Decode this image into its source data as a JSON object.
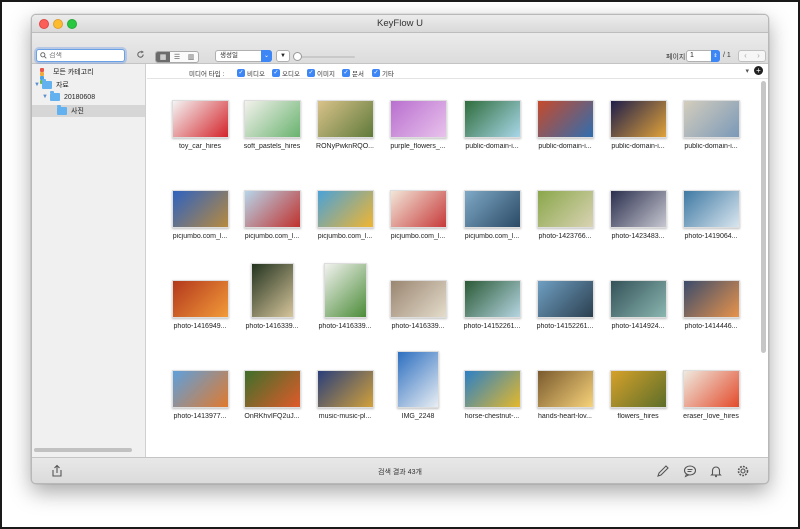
{
  "window": {
    "title": "KeyFlow U"
  },
  "toolbar": {
    "search_placeholder": "검색",
    "sort_value": "생성일",
    "page_label": "페이지",
    "page_value": "1",
    "page_total": "/ 1"
  },
  "sidebar": {
    "all_categories": "모든 카테고리",
    "library": "자료",
    "folder_date": "20180608",
    "folder_photos": "사진"
  },
  "filter": {
    "label": "미디어 타입 :",
    "types": [
      "비디오",
      "오디오",
      "이미지",
      "문서",
      "기타"
    ]
  },
  "items": [
    {
      "name": "toy_car_hires",
      "c1": "#f4f4f4",
      "c2": "#d3242a"
    },
    {
      "name": "soft_pastels_hires",
      "c1": "#f3f1ec",
      "c2": "#69b36f"
    },
    {
      "name": "RONyPwknRQO...",
      "c1": "#d9c28a",
      "c2": "#5f7a3a"
    },
    {
      "name": "purple_flowers_...",
      "c1": "#b96fcf",
      "c2": "#e8c2ec"
    },
    {
      "name": "public-domain-i...",
      "c1": "#2f6d3c",
      "c2": "#a8d7e9"
    },
    {
      "name": "public-domain-i...",
      "c1": "#c64a2b",
      "c2": "#2f6eb0"
    },
    {
      "name": "public-domain-i...",
      "c1": "#1f1f4a",
      "c2": "#e0a23a"
    },
    {
      "name": "public-domain-i...",
      "c1": "#d4cdbd",
      "c2": "#7a99b8"
    },
    {
      "name": "picjumbo.com_l...",
      "c1": "#2e62c0",
      "c2": "#b78a3e"
    },
    {
      "name": "picjumbo.com_l...",
      "c1": "#b7d5ea",
      "c2": "#c0312d"
    },
    {
      "name": "picjumbo.com_l...",
      "c1": "#4aa2d8",
      "c2": "#f0b531"
    },
    {
      "name": "picjumbo.com_l...",
      "c1": "#f2e6d8",
      "c2": "#c73a3a"
    },
    {
      "name": "picjumbo.com_l...",
      "c1": "#7ea9c6",
      "c2": "#2b4a66"
    },
    {
      "name": "photo-1423766...",
      "c1": "#8aa74a",
      "c2": "#d9d3b4"
    },
    {
      "name": "photo-1423483...",
      "c1": "#2a2f4d",
      "c2": "#c7c7d1"
    },
    {
      "name": "photo-1419064...",
      "c1": "#3f79a3",
      "c2": "#d9e6ef"
    },
    {
      "name": "photo-1416949...",
      "c1": "#b3381d",
      "c2": "#f29b39"
    },
    {
      "name": "photo-1416339...",
      "c1": "#23331f",
      "c2": "#d6c59b"
    },
    {
      "name": "photo-1416339...",
      "c1": "#f2f2ef",
      "c2": "#4b8c38"
    },
    {
      "name": "photo-1416339...",
      "c1": "#9a8671",
      "c2": "#e4dccb"
    },
    {
      "name": "photo-14152261...",
      "c1": "#2b5a36",
      "c2": "#b5d5e2"
    },
    {
      "name": "photo-14152261...",
      "c1": "#6f9fc2",
      "c2": "#2b3f4f"
    },
    {
      "name": "photo-1414924...",
      "c1": "#345259",
      "c2": "#8ab6b0"
    },
    {
      "name": "photo-1414446...",
      "c1": "#3b4c6c",
      "c2": "#e8934a"
    },
    {
      "name": "photo-1413977...",
      "c1": "#5ea0dc",
      "c2": "#e07a2d"
    },
    {
      "name": "OnRKhvIFQ2uJ...",
      "c1": "#3f6f2a",
      "c2": "#e05a2a"
    },
    {
      "name": "music-music-pl...",
      "c1": "#2a3f7a",
      "c2": "#d2a13a"
    },
    {
      "name": "IMG_2248",
      "c1": "#2c6fc0",
      "c2": "#e9eef3"
    },
    {
      "name": "horse-chestnut-...",
      "c1": "#2c80c6",
      "c2": "#e3b82c"
    },
    {
      "name": "hands-heart-lov...",
      "c1": "#7a5a2e",
      "c2": "#f7d37a"
    },
    {
      "name": "flowers_hires",
      "c1": "#d6a12a",
      "c2": "#5c6e2a"
    },
    {
      "name": "eraser_love_hires",
      "c1": "#efe9df",
      "c2": "#e34a2a"
    },
    {
      "name": "",
      "c1": "#9a7b63",
      "c2": "#cab29a"
    },
    {
      "name": "",
      "c1": "#4a7fb0",
      "c2": "#c9d9e5"
    },
    {
      "name": "",
      "c1": "#6a8a5a",
      "c2": "#c3b7a0"
    },
    {
      "name": "",
      "c1": "#5a4a3a",
      "c2": "#d0b27a"
    },
    {
      "name": "",
      "c1": "#3a5a7a",
      "c2": "#9ab5cc"
    },
    {
      "name": "",
      "c1": "#7aa3c2",
      "c2": "#e2ddd3"
    },
    {
      "name": "",
      "c1": "#c04a3a",
      "c2": "#e9c9a0"
    },
    {
      "name": "",
      "c1": "#4a4a4a",
      "c2": "#b0b0b0"
    }
  ],
  "status": {
    "text": "검색 결과 43개"
  },
  "colors": {
    "accent": "#3d86f5",
    "folder": "#64b1f0"
  },
  "icons": [
    "share-icon",
    "pencil-icon",
    "chat-icon",
    "bell-icon",
    "gear-icon"
  ]
}
